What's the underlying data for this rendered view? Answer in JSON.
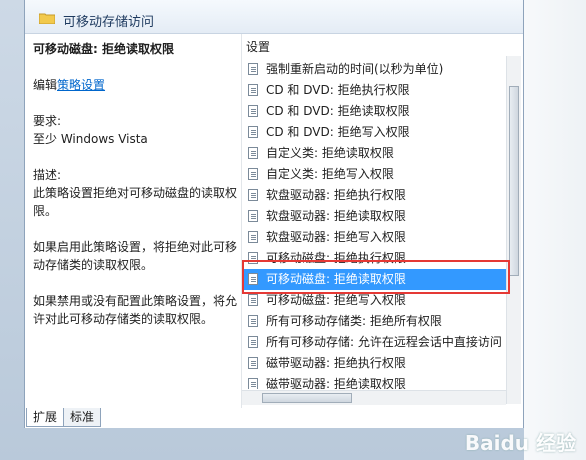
{
  "header": {
    "title": "可移动存储访问"
  },
  "description": {
    "title": "可移动磁盘: 拒绝读取权限",
    "edit_prefix": "编辑",
    "edit_link": "策略设置",
    "requirement_label": "要求:",
    "requirement_value": "至少 Windows Vista",
    "desc_label": "描述:",
    "desc_text": "此策略设置拒绝对可移动磁盘的读取权限。",
    "enabled_text": "如果启用此策略设置，将拒绝对此可移动存储类的读取权限。",
    "disabled_text": "如果禁用或没有配置此策略设置，将允许对此可移动存储类的读取权限。"
  },
  "list": {
    "header": "设置",
    "items": [
      "强制重新启动的时间(以秒为单位)",
      "CD 和 DVD: 拒绝执行权限",
      "CD 和 DVD: 拒绝读取权限",
      "CD 和 DVD: 拒绝写入权限",
      "自定义类: 拒绝读取权限",
      "自定义类: 拒绝写入权限",
      "软盘驱动器: 拒绝执行权限",
      "软盘驱动器: 拒绝读取权限",
      "软盘驱动器: 拒绝写入权限",
      "可移动磁盘: 拒绝执行权限",
      "可移动磁盘: 拒绝读取权限",
      "可移动磁盘: 拒绝写入权限",
      "所有可移动存储类: 拒绝所有权限",
      "所有可移动存储: 允许在远程会话中直接访问",
      "磁带驱动器: 拒绝执行权限",
      "磁带驱动器: 拒绝读取权限"
    ],
    "selected_index": 10
  },
  "tabs": [
    {
      "label": "扩展"
    },
    {
      "label": "标准"
    }
  ],
  "watermark": "Baidu 经验"
}
